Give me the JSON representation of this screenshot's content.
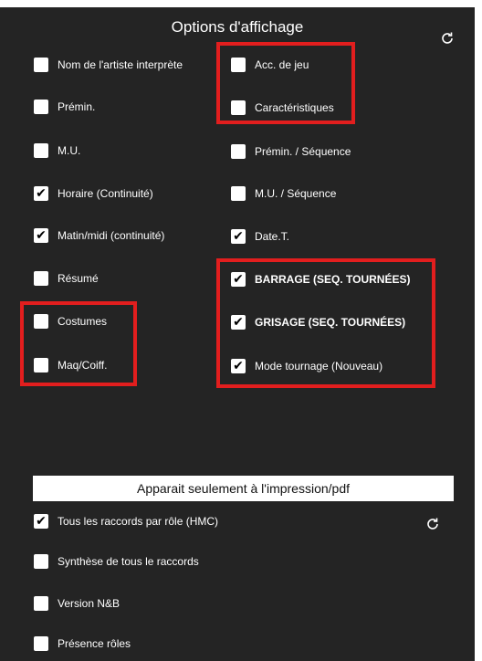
{
  "title": "Options d'affichage",
  "icons": {
    "refresh": "refresh-icon"
  },
  "colors": {
    "panel": "#242424",
    "highlight": "#e21e1e",
    "checkbox": "#ffffff"
  },
  "left_options": [
    {
      "label": "Nom de l'artiste interprète",
      "checked": false
    },
    {
      "label": "Prémin.",
      "checked": false
    },
    {
      "label": "M.U.",
      "checked": false
    },
    {
      "label": "Horaire (Continuité)",
      "checked": true
    },
    {
      "label": "Matin/midi (continuité)",
      "checked": true
    },
    {
      "label": "Résumé",
      "checked": false
    },
    {
      "label": "Costumes",
      "checked": false
    },
    {
      "label": "Maq/Coiff.",
      "checked": false
    }
  ],
  "right_options": [
    {
      "label": "Acc. de jeu",
      "checked": false
    },
    {
      "label": "Caractéristiques",
      "checked": false
    },
    {
      "label": "Prémin. / Séquence",
      "checked": false
    },
    {
      "label": "M.U. / Séquence",
      "checked": false
    },
    {
      "label": "Date.T.",
      "checked": true
    },
    {
      "label": "BARRAGE (SEQ. TOURNÉES)",
      "checked": true
    },
    {
      "label": "GRISAGE (SEQ. TOURNÉES)",
      "checked": true
    },
    {
      "label": "Mode tournage (Nouveau)",
      "checked": true
    }
  ],
  "print_section": {
    "banner": "Apparait seulement à l'impression/pdf",
    "options": [
      {
        "label": "Tous les raccords par rôle (HMC)",
        "checked": true
      },
      {
        "label": "Synthèse de tous le raccords",
        "checked": false
      },
      {
        "label": "Version N&B",
        "checked": false
      },
      {
        "label": "Présence rôles",
        "checked": false
      }
    ]
  }
}
